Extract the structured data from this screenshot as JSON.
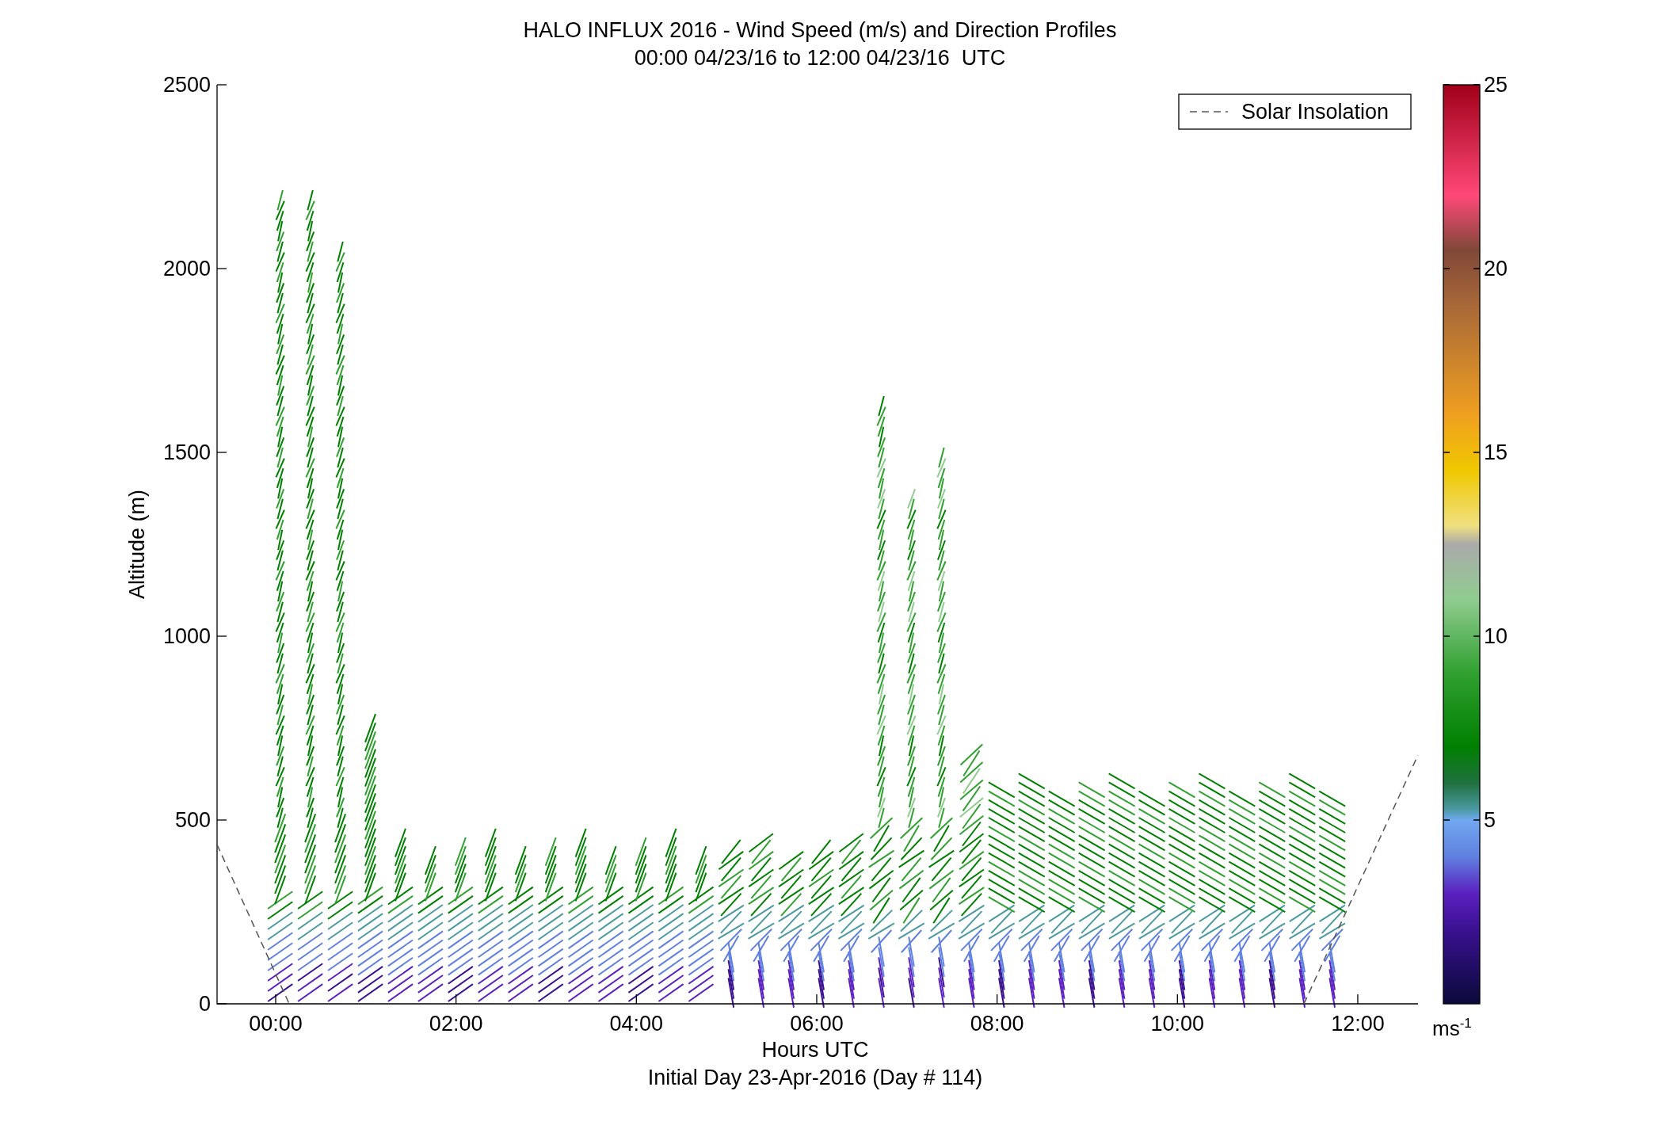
{
  "title": [
    "HALO INFLUX 2016 - Wind Speed (m/s) and Direction Profiles",
    "00:00 04/23/16 to 12:00 04/23/16  UTC"
  ],
  "y_axis": {
    "label": "Altitude (m)",
    "ticks": [
      "2500",
      "2000",
      "1500",
      "1000",
      "500",
      "0"
    ]
  },
  "x_axis": {
    "label": "Hours UTC",
    "ticks": [
      "00:00",
      "02:00",
      "04:00",
      "06:00",
      "08:00",
      "10:00",
      "12:00"
    ]
  },
  "subtitle": "Initial Day 23-Apr-2016 (Day # 114)",
  "legend": {
    "label": "Solar Insolation"
  },
  "colorbar": {
    "ticks": [
      "25",
      "20",
      "15",
      "10",
      "5"
    ],
    "unit": "ms$^{-1}$"
  }
}
